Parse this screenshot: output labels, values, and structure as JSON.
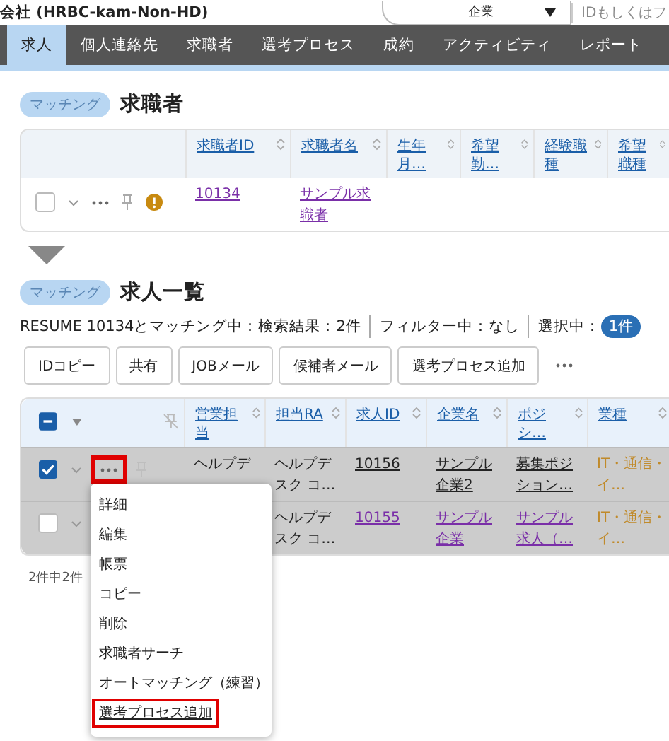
{
  "header": {
    "company": "会社 (HRBC-kam-Non-HD)",
    "search_scope": "企業",
    "search_placeholder": "IDもしくはフ"
  },
  "nav": [
    {
      "label": "求人",
      "selected": true
    },
    {
      "label": "個人連絡先",
      "selected": false
    },
    {
      "label": "求職者",
      "selected": false
    },
    {
      "label": "選考プロセス",
      "selected": false
    },
    {
      "label": "成約",
      "selected": false
    },
    {
      "label": "アクティビティ",
      "selected": false
    },
    {
      "label": "レポート",
      "selected": false
    }
  ],
  "source": {
    "badge": "マッチング",
    "title": "求職者",
    "columns": [
      "求職者ID",
      "求職者名",
      "生年月…",
      "希望勤…",
      "経験職種",
      "希望職種"
    ],
    "rows": [
      {
        "checked": false,
        "warning": true,
        "cells": [
          {
            "text": "10134",
            "kind": "visited"
          },
          {
            "text": "サンプル求職者",
            "kind": "visited"
          }
        ]
      }
    ]
  },
  "results": {
    "badge": "マッチング",
    "title": "求人一覧",
    "summary": "RESUME 10134とマッチング中：検索結果：2件",
    "filter": "フィルター中：なし",
    "selection_label": "選択中：",
    "selection_count": "1件",
    "buttons": [
      "IDコピー",
      "共有",
      "JOBメール",
      "候補者メール",
      "選考プロセス追加"
    ],
    "header_indeterminate": true,
    "columns": [
      "営業担当",
      "担当RA",
      "求人ID",
      "企業名",
      "ポジシ…",
      "業種"
    ],
    "rows": [
      {
        "checked": true,
        "menu_open": true,
        "cells": [
          {
            "text": "ヘルプデ",
            "kind": "text"
          },
          {
            "text": "ヘルプデスク コ…",
            "kind": "text"
          },
          {
            "text": "10156",
            "kind": "link"
          },
          {
            "text": "サンプル企業2",
            "kind": "link"
          },
          {
            "text": "募集ポジション…",
            "kind": "link"
          },
          {
            "text": "IT・通信・イ…",
            "kind": "tag"
          }
        ]
      },
      {
        "checked": false,
        "menu_open": false,
        "cells": [
          {
            "kind": "covered"
          },
          {
            "text": "ヘルプデスク コ…",
            "kind": "text"
          },
          {
            "text": "10155",
            "kind": "visited"
          },
          {
            "text": "サンプル企業",
            "kind": "visited"
          },
          {
            "text": "サンプル求人（…",
            "kind": "visited"
          },
          {
            "text": "IT・通信・イ…",
            "kind": "tag"
          }
        ]
      }
    ],
    "footer": "2件中2件",
    "menu": [
      {
        "label": "詳細",
        "highlighted": false
      },
      {
        "label": "編集",
        "highlighted": false
      },
      {
        "label": "帳票",
        "highlighted": false
      },
      {
        "label": "コピー",
        "highlighted": false
      },
      {
        "label": "削除",
        "highlighted": false
      },
      {
        "label": "求職者サーチ",
        "highlighted": false
      },
      {
        "label": "オートマッチング（練習）",
        "highlighted": false
      },
      {
        "label": "選考プロセス追加",
        "highlighted": true
      }
    ]
  }
}
